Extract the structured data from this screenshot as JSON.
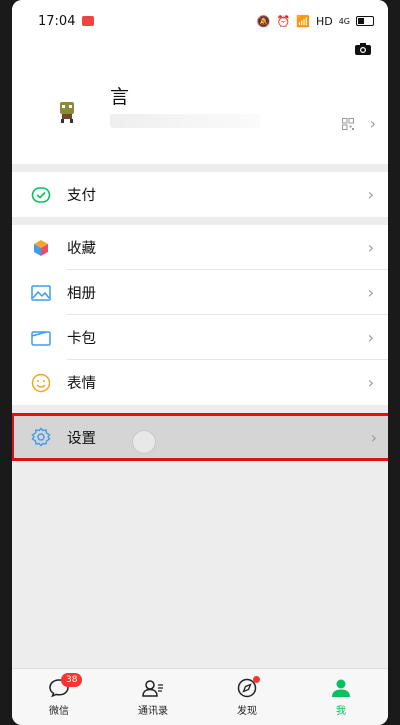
{
  "status": {
    "time": "17:04",
    "net": "HD",
    "signal": "4G"
  },
  "profile": {
    "name": "言"
  },
  "menu": {
    "pay": "支付",
    "favorites": "收藏",
    "album": "相册",
    "cards": "卡包",
    "stickers": "表情",
    "settings": "设置"
  },
  "tabs": [
    {
      "label": "微信",
      "badge": "38"
    },
    {
      "label": "通讯录"
    },
    {
      "label": "发现"
    },
    {
      "label": "我"
    }
  ],
  "colors": {
    "accent": "#07c160",
    "badge": "#f43530",
    "highlight_border": "#e0101a"
  }
}
